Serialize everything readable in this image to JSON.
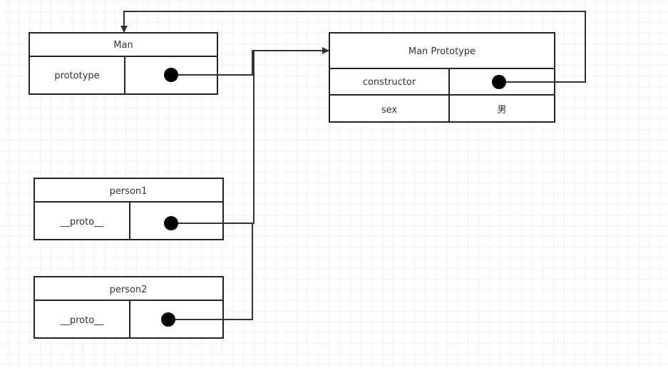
{
  "nodes": {
    "man": {
      "title": "Man",
      "rows": [
        {
          "key": "prototype",
          "value": ""
        }
      ]
    },
    "man_prototype": {
      "title": "Man Prototype",
      "rows": [
        {
          "key": "constructor",
          "value": ""
        },
        {
          "key": "sex",
          "value": "男"
        }
      ]
    },
    "person1": {
      "title": "person1",
      "rows": [
        {
          "key": "__proto__",
          "value": ""
        }
      ]
    },
    "person2": {
      "title": "person2",
      "rows": [
        {
          "key": "__proto__",
          "value": ""
        }
      ]
    }
  },
  "colors": {
    "line": "#333333",
    "grid": "#e6e6e6",
    "box_border": "#222222"
  }
}
